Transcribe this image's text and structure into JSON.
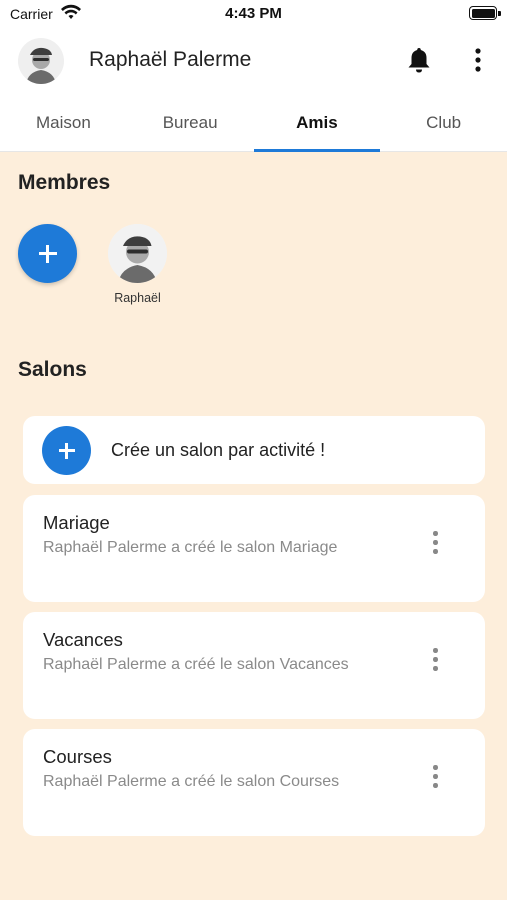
{
  "status_bar": {
    "carrier": "Carrier",
    "time": "4:43 PM",
    "icons": [
      "wifi-icon",
      "battery-icon"
    ]
  },
  "header": {
    "user_name": "Raphaël Palerme",
    "icons": [
      "avatar",
      "bell-icon",
      "more-vert-icon"
    ]
  },
  "tabs": [
    {
      "label": "Maison",
      "active": false
    },
    {
      "label": "Bureau",
      "active": false
    },
    {
      "label": "Amis",
      "active": true
    },
    {
      "label": "Club",
      "active": false
    }
  ],
  "members": {
    "title": "Membres",
    "list": [
      {
        "name": "Raphaël"
      }
    ]
  },
  "salons": {
    "title": "Salons",
    "create_label": "Crée un salon par activité !",
    "items": [
      {
        "title": "Mariage",
        "subtitle": "Raphaël Palerme a créé le salon Mariage"
      },
      {
        "title": "Vacances",
        "subtitle": "Raphaël Palerme a créé le salon Vacances"
      },
      {
        "title": "Courses",
        "subtitle": "Raphaël Palerme a créé le salon Courses"
      }
    ]
  },
  "colors": {
    "accent": "#1e7ad8",
    "background": "#fdeedb",
    "card": "#ffffff",
    "subtitle_text": "#8a8a8a"
  }
}
